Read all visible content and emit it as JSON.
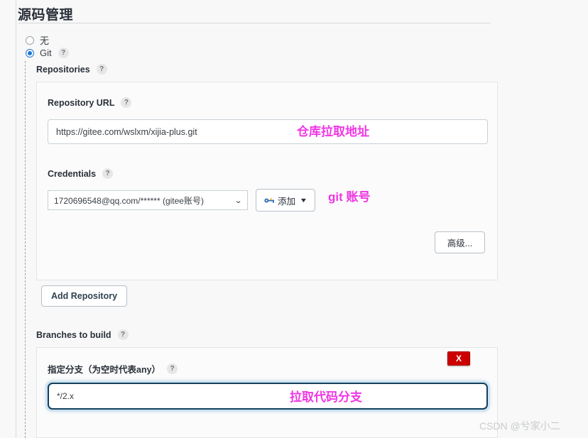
{
  "section": {
    "title": "源码管理"
  },
  "scm_options": [
    {
      "label": "无",
      "selected": false,
      "has_help": false
    },
    {
      "label": "Git",
      "selected": true,
      "has_help": true
    }
  ],
  "repositories": {
    "group_label": "Repositories",
    "help": "?",
    "repository_url": {
      "label": "Repository URL",
      "help": "?",
      "value": "https://gitee.com/wslxm/xijia-plus.git",
      "annotation": "仓库拉取地址"
    },
    "credentials": {
      "label": "Credentials",
      "help": "?",
      "selected_value": "1720696548@qq.com/****** (gitee账号)",
      "caret": "⌄",
      "add_button": {
        "label": "添加",
        "icon": "key-icon",
        "caret": "▼"
      },
      "annotation": "git 账号"
    },
    "advanced_button": "高级...",
    "add_repository_button": "Add Repository"
  },
  "branches": {
    "group_label": "Branches to build",
    "help": "?",
    "branch_spec": {
      "label": "指定分支（为空时代表any）",
      "help": "?",
      "value": "*/2.x",
      "annotation": "拉取代码分支"
    },
    "delete_button": "X"
  },
  "watermark": "CSDN @兮家小二",
  "colors": {
    "accent_blue": "#1b76d4",
    "annotation_pink": "#ef37e4",
    "delete_red": "#cc0000",
    "focus_border": "#11405c",
    "page_bg": "#f8f8f8"
  }
}
